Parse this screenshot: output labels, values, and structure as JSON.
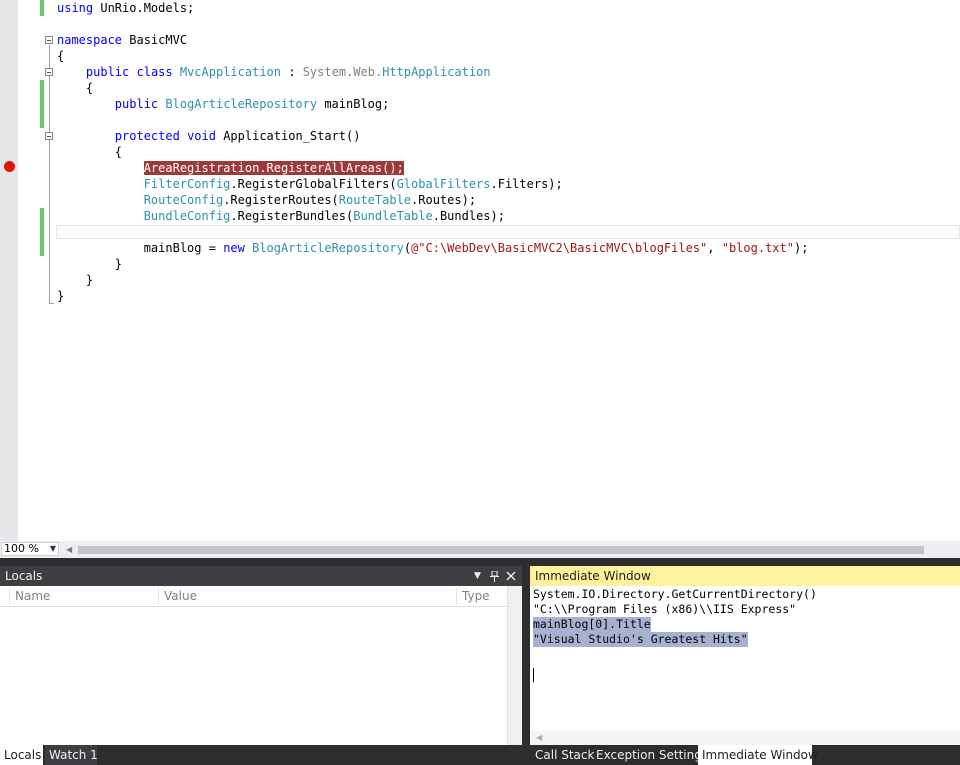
{
  "editor": {
    "lines": {
      "l1": {
        "kw": "using",
        "rest": " UnRio.Models;"
      },
      "l3": {
        "kw": "namespace",
        "rest": " BasicMVC"
      },
      "l4": {
        "text": "{"
      },
      "l5": {
        "kw1": "public",
        "kw2": "class",
        "type": "MvcApplication",
        "mid": " : ",
        "gray": "System.Web.",
        "type2": "HttpApplication"
      },
      "l6": {
        "text": "{"
      },
      "l7": {
        "kw": "public",
        "type": "BlogArticleRepository",
        "rest": " mainBlog;"
      },
      "l9": {
        "kw1": "protected",
        "kw2": "void",
        "rest": " Application_Start()"
      },
      "l10": {
        "text": "{"
      },
      "l11": {
        "text": "AreaRegistration.RegisterAllAreas();"
      },
      "l12": {
        "type": "FilterConfig",
        "mid": ".RegisterGlobalFilters(",
        "type2": "GlobalFilters",
        "rest": ".Filters);"
      },
      "l13": {
        "type": "RouteConfig",
        "mid": ".RegisterRoutes(",
        "type2": "RouteTable",
        "rest": ".Routes);"
      },
      "l14": {
        "type": "BundleConfig",
        "mid": ".RegisterBundles(",
        "type2": "BundleTable",
        "rest": ".Bundles);"
      },
      "l16": {
        "pre": "mainBlog = ",
        "kw": "new",
        "type": "BlogArticleRepository",
        "p1": "(",
        "str1": "@\"C:\\WebDev\\BasicMVC2\\BasicMVC\\blogFiles\"",
        "p2": ", ",
        "str2": "\"blog.txt\"",
        "p3": ");"
      },
      "l17": {
        "text": "}"
      },
      "l18": {
        "text": "}"
      },
      "l19": {
        "text": "}"
      }
    }
  },
  "zoom": {
    "value": "100 %"
  },
  "locals": {
    "title": "Locals",
    "dropdown_icon": "chevron-down-icon",
    "pin_icon": "pin-icon",
    "close_icon": "close-icon",
    "columns": {
      "name": "Name",
      "value": "Value",
      "type": "Type"
    }
  },
  "immediate": {
    "title": "Immediate Window",
    "lines": [
      "System.IO.Directory.GetCurrentDirectory()",
      "\"C:\\\\Program Files (x86)\\\\IIS Express\"",
      "mainBlog[0].Title",
      "\"Visual Studio's Greatest Hits\""
    ]
  },
  "tabs_left": [
    {
      "label": "Locals",
      "active": true
    },
    {
      "label": "Watch 1",
      "active": false
    }
  ],
  "tabs_right": [
    {
      "label": "Call Stack",
      "active": false
    },
    {
      "label": "Exception Settings",
      "active": false
    },
    {
      "label": "Immediate Window",
      "active": true
    }
  ],
  "colors": {
    "keyword": "#0000ff",
    "type": "#2b91af",
    "string": "#a31515",
    "breakpoint": "#e51400",
    "breakpoint_highlight": "#9e3939",
    "immediate_title": "#fff29d"
  }
}
